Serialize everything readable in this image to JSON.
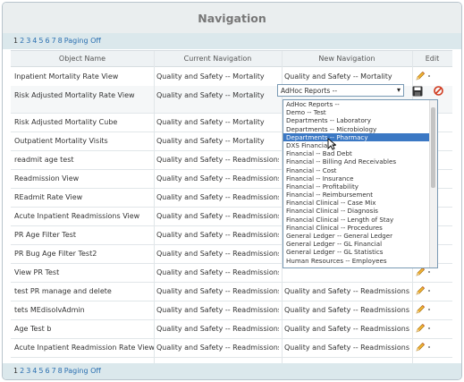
{
  "title": "Navigation",
  "pager": {
    "current": "1",
    "pages": [
      "2",
      "3",
      "4",
      "5",
      "6",
      "7",
      "8"
    ],
    "paging_off": "Paging Off"
  },
  "columns": {
    "object_name": "Object Name",
    "current_navigation": "Current Navigation",
    "new_navigation": "New Navigation",
    "edit": "Edit"
  },
  "rows": [
    {
      "name": "Inpatient Mortality Rate View",
      "current": "Quality and Safety -- Mortality",
      "new": "Quality and Safety -- Mortality"
    },
    {
      "name": "Risk Adjusted Mortality Rate View",
      "current": "Quality and Safety -- Mortality",
      "new": ""
    },
    {
      "name": "Risk Adjusted Mortality Cube",
      "current": "Quality and Safety -- Mortality",
      "new": ""
    },
    {
      "name": "Outpatient Mortality Visits",
      "current": "Quality and Safety -- Mortality",
      "new": ""
    },
    {
      "name": "readmit age test",
      "current": "Quality and Safety -- Readmissions",
      "new": ""
    },
    {
      "name": "Readmission View",
      "current": "Quality and Safety -- Readmissions",
      "new": ""
    },
    {
      "name": "REadmit Rate View",
      "current": "Quality and Safety -- Readmissions",
      "new": ""
    },
    {
      "name": "Acute Inpatient Readmissions View",
      "current": "Quality and Safety -- Readmissions",
      "new": ""
    },
    {
      "name": "PR Age Filter Test",
      "current": "Quality and Safety -- Readmissions",
      "new": ""
    },
    {
      "name": "PR Bug Age Filter Test2",
      "current": "Quality and Safety -- Readmissions",
      "new": ""
    },
    {
      "name": "View PR Test",
      "current": "Quality and Safety -- Readmissions",
      "new": ""
    },
    {
      "name": "test PR manage and delete",
      "current": "Quality and Safety -- Readmissions",
      "new": "Quality and Safety -- Readmissions"
    },
    {
      "name": "tets MEdisolvAdmin",
      "current": "Quality and Safety -- Readmissions",
      "new": "Quality and Safety -- Readmissions"
    },
    {
      "name": "Age Test b",
      "current": "Quality and Safety -- Readmissions",
      "new": "Quality and Safety -- Readmissions"
    },
    {
      "name": "Acute Inpatient Readmission Rate View",
      "current": "Quality and Safety -- Readmissions",
      "new": "Quality and Safety -- Readmissions"
    }
  ],
  "select": {
    "value": "AdHoc Reports --"
  },
  "options": [
    "AdHoc Reports --",
    "Demo -- Test",
    "Departments -- Laboratory",
    "Departments -- Microbiology",
    "Departments -- Pharmacy",
    "DXS Financial --",
    "Financial -- Bad Debt",
    "Financial -- Billing And Receivables",
    "Financial -- Cost",
    "Financial -- Insurance",
    "Financial -- Profitability",
    "Financial -- Reimbursement",
    "Financial Clinical -- Case Mix",
    "Financial Clinical -- Diagnosis",
    "Financial Clinical -- Length of Stay",
    "Financial Clinical -- Procedures",
    "General Ledger -- General Ledger",
    "General Ledger -- GL Financial",
    "General Ledger -- GL Statistics",
    "Human Resources -- Employees"
  ],
  "selected_option": "Departments -- Pharmacy",
  "icons": {
    "edit": "pencil-icon",
    "save": "save-icon",
    "cancel": "cancel-icon"
  },
  "colors": {
    "link": "#2a6fb0",
    "highlight": "#3b78c4",
    "header_bg": "#eaeeef",
    "pager_bg": "#dbe8ec"
  }
}
